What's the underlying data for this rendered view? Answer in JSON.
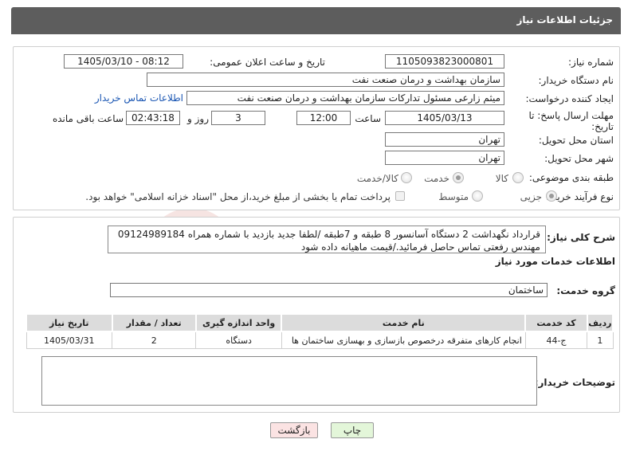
{
  "header": {
    "title": "جزئیات اطلاعات نیاز"
  },
  "form": {
    "need_number_label": "شماره نیاز:",
    "need_number": "1105093823000801",
    "announce_label": "تاریخ و ساعت اعلان عمومی:",
    "announce_value": "1405/03/10 - 08:12",
    "buyer_org_label": "نام دستگاه خریدار:",
    "buyer_org": "سازمان بهداشت و درمان صنعت نفت",
    "creator_label": "ایجاد کننده درخواست:",
    "creator": "میثم زارعی مسئول تداركات سازمان بهداشت و درمان صنعت نفت",
    "contact_link": "اطلاعات تماس خریدار",
    "deadline_label_line1": "مهلت ارسال پاسخ: تا",
    "deadline_label_line2": "تاریخ:",
    "deadline_date": "1405/03/13",
    "time_label": "ساعت",
    "deadline_time": "12:00",
    "days_value": "3",
    "days_label": "روز و",
    "remaining_time": "02:43:18",
    "remaining_label": "ساعت باقی مانده",
    "province_label": "استان محل تحویل:",
    "province": "تهران",
    "city_label": "شهر محل تحویل:",
    "city": "تهران",
    "category_label": "طبقه بندی موضوعی:",
    "category_options": [
      "کالا",
      "خدمت",
      "کالا/خدمت"
    ],
    "category_selected": "خدمت",
    "process_label": "نوع فرآیند خرید :",
    "process_options": [
      "جزیی",
      "متوسط"
    ],
    "process_selected": "جزیی",
    "payment_note": "پرداخت تمام یا بخشی از مبلغ خرید،از محل \"اسناد خزانه اسلامی\" خواهد بود."
  },
  "summary": {
    "label": "شرح کلی نیاز:",
    "text": "قرارداد نگهداشت 2 دستگاه آسانسور 8 طبقه و 7طبقه /لطفا جدید بازدید با شماره همراه 09124989184 مهندس رفعتی تماس حاصل فرمائید./قیمت ماهیانه داده شود"
  },
  "services": {
    "section_title": "اطلاعات خدمات مورد نیاز",
    "group_label": "گروه خدمت:",
    "group_value": "ساختمان",
    "columns": [
      "ردیف",
      "کد خدمت",
      "نام خدمت",
      "واحد اندازه گیری",
      "تعداد / مقدار",
      "تاریخ نیاز"
    ],
    "rows": [
      [
        "1",
        "ج-44",
        "انجام کارهای متفرقه درخصوص بازسازی و بهسازی ساختمان ها",
        "دستگاه",
        "2",
        "1405/03/31"
      ]
    ]
  },
  "buyer_notes": {
    "label": "توضیحات خریدار:",
    "value": ""
  },
  "buttons": {
    "print": "چاپ",
    "back": "بازگشت"
  },
  "colors": {
    "header_bg": "#5d5d5d",
    "print_bg": "#e3f6d9",
    "back_bg": "#fbe3e3",
    "link": "#1a56b3"
  }
}
